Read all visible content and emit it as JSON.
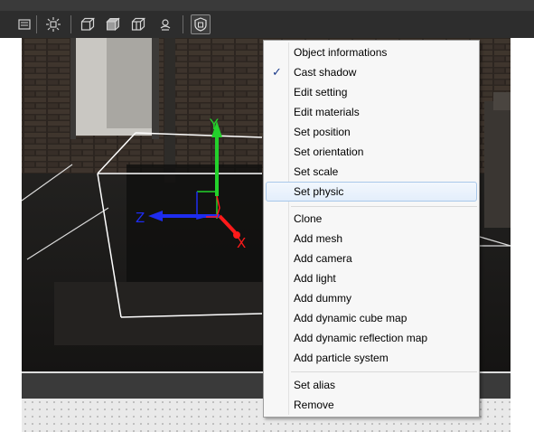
{
  "toolbar": {
    "buttons": [
      {
        "icon": "list-icon"
      },
      {
        "icon": "light-icon"
      },
      {
        "icon": "wire-box-icon"
      },
      {
        "icon": "solid-box-icon"
      },
      {
        "icon": "textured-box-icon"
      },
      {
        "icon": "settings-icon"
      },
      {
        "icon": "shield-cube-icon",
        "pressed": true
      }
    ]
  },
  "viewport": {
    "gizmo": {
      "y_label": "Y",
      "z_label": "Z",
      "x_label": "X"
    },
    "colors": {
      "y_axis": "#23d12b",
      "z_axis": "#1e2cf0",
      "x_axis": "#ff1a1a"
    }
  },
  "context_menu": {
    "items": [
      {
        "label": "Object informations"
      },
      {
        "label": "Cast shadow",
        "checked": true
      },
      {
        "label": "Edit setting"
      },
      {
        "label": "Edit materials"
      },
      {
        "label": "Set position"
      },
      {
        "label": "Set orientation"
      },
      {
        "label": "Set scale"
      },
      {
        "label": "Set physic",
        "highlighted": true
      },
      {
        "label": "Clone"
      },
      {
        "label": "Add mesh"
      },
      {
        "label": "Add camera"
      },
      {
        "label": "Add light"
      },
      {
        "label": "Add dummy"
      },
      {
        "label": "Add dynamic cube map"
      },
      {
        "label": "Add dynamic reflection map"
      },
      {
        "label": "Add particle system"
      },
      {
        "label": "Set alias"
      },
      {
        "label": "Remove"
      }
    ],
    "check_glyph": "✓"
  }
}
